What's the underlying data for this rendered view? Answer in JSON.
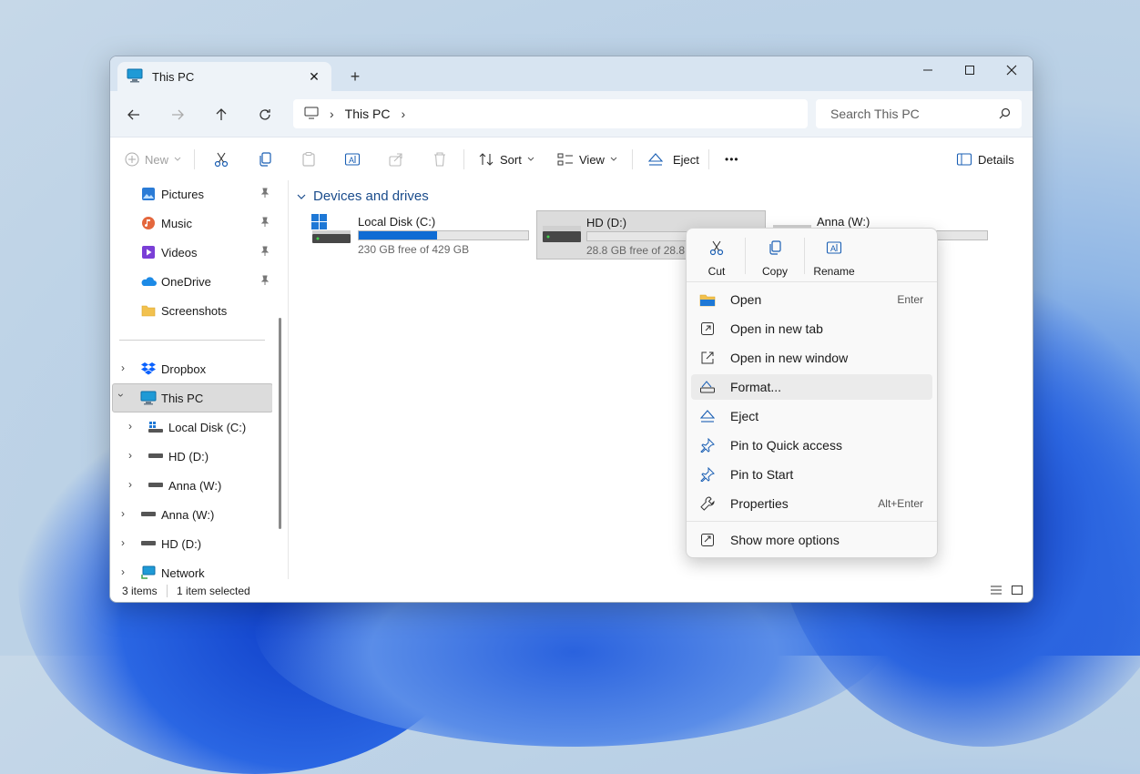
{
  "window": {
    "tab_title": "This PC",
    "new_tab_glyph": "+",
    "close_tab_glyph": "✕"
  },
  "nav": {
    "breadcrumb": [
      "This PC"
    ],
    "search_placeholder": "Search This PC"
  },
  "toolbar": {
    "new_label": "New",
    "sort_label": "Sort",
    "view_label": "View",
    "eject_label": "Eject",
    "more_glyph": "•••",
    "details_label": "Details"
  },
  "sidebar": {
    "items": [
      {
        "label": "Pictures",
        "icon": "pictures-icon",
        "pinned": true
      },
      {
        "label": "Music",
        "icon": "music-icon",
        "pinned": true
      },
      {
        "label": "Videos",
        "icon": "videos-icon",
        "pinned": true
      },
      {
        "label": "OneDrive",
        "icon": "onedrive-icon",
        "pinned": true
      },
      {
        "label": "Screenshots",
        "icon": "folder-icon",
        "pinned": false
      },
      {
        "label": "Dropbox",
        "icon": "dropbox-icon"
      },
      {
        "label": "This PC",
        "icon": "pc-icon",
        "selected": true,
        "expanded": true
      },
      {
        "label": "Local Disk (C:)",
        "icon": "windows-drive-icon"
      },
      {
        "label": "HD (D:)",
        "icon": "drive-icon"
      },
      {
        "label": "Anna (W:)",
        "icon": "drive-icon"
      },
      {
        "label": "Anna (W:)",
        "icon": "drive-icon"
      },
      {
        "label": "HD (D:)",
        "icon": "drive-icon"
      },
      {
        "label": "Network",
        "icon": "network-icon"
      }
    ]
  },
  "content": {
    "group_title": "Devices and drives",
    "drives": [
      {
        "name": "Local Disk (C:)",
        "free": "230 GB free of 429 GB",
        "used_fraction": 0.46
      },
      {
        "name": "HD (D:)",
        "free": "28.8 GB free of 28.8 GB",
        "used_fraction": 0.0
      },
      {
        "name": "Anna (W:)",
        "free": "",
        "used_fraction": 0.0
      }
    ]
  },
  "status": {
    "items_count": "3 items",
    "selection": "1 item selected"
  },
  "context_menu": {
    "quick_actions": [
      {
        "label": "Cut",
        "icon": "cut-icon"
      },
      {
        "label": "Copy",
        "icon": "copy-icon"
      },
      {
        "label": "Rename",
        "icon": "rename-icon"
      }
    ],
    "items": [
      {
        "label": "Open",
        "shortcut": "Enter",
        "icon": "open-folder-icon"
      },
      {
        "label": "Open in new tab",
        "shortcut": "",
        "icon": "new-tab-icon"
      },
      {
        "label": "Open in new window",
        "shortcut": "",
        "icon": "new-window-icon"
      },
      {
        "label": "Format...",
        "shortcut": "",
        "icon": "format-icon",
        "highlighted": true
      },
      {
        "label": "Eject",
        "shortcut": "",
        "icon": "eject-icon"
      },
      {
        "label": "Pin to Quick access",
        "shortcut": "",
        "icon": "pin-icon"
      },
      {
        "label": "Pin to Start",
        "shortcut": "",
        "icon": "pin-icon"
      },
      {
        "label": "Properties",
        "shortcut": "Alt+Enter",
        "icon": "wrench-icon"
      }
    ],
    "more_options": {
      "label": "Show more options",
      "icon": "more-options-icon"
    }
  },
  "colors": {
    "accent": "#0f6cd4",
    "group_header": "#1a4c8c",
    "titlebar": "#d7e4f1"
  }
}
